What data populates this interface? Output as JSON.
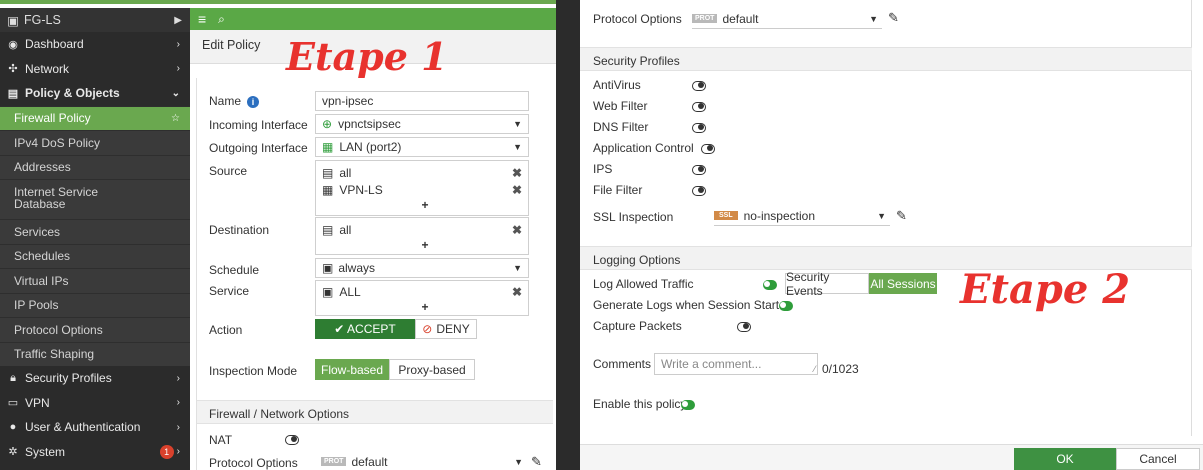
{
  "app": {
    "title": "FG-LS"
  },
  "topbar": {
    "menu_icon": "≡",
    "search_icon": "🔍"
  },
  "sidebar": {
    "items": [
      {
        "label": "Dashboard",
        "icon": "dashboard-icon"
      },
      {
        "label": "Network",
        "icon": "network-icon"
      },
      {
        "label": "Policy & Objects",
        "icon": "policy-icon"
      },
      {
        "label": "Firewall Policy"
      },
      {
        "label": "IPv4 DoS Policy"
      },
      {
        "label": "Addresses"
      },
      {
        "label": "Internet Service Database"
      },
      {
        "label": "Services"
      },
      {
        "label": "Schedules"
      },
      {
        "label": "Virtual IPs"
      },
      {
        "label": "IP Pools"
      },
      {
        "label": "Protocol Options"
      },
      {
        "label": "Traffic Shaping"
      },
      {
        "label": "Security Profiles",
        "icon": "lock-icon"
      },
      {
        "label": "VPN",
        "icon": "monitor-icon"
      },
      {
        "label": "User & Authentication",
        "icon": "user-icon"
      },
      {
        "label": "System",
        "icon": "gear-icon",
        "badge": "1"
      }
    ]
  },
  "edit": {
    "title": "Edit Policy"
  },
  "annotations": {
    "step1": "Etape 1",
    "step2": "Etape 2"
  },
  "form": {
    "name_label": "Name",
    "name_value": "vpn-ipsec",
    "incoming_label": "Incoming Interface",
    "incoming_value": "vpnctsipsec",
    "outgoing_label": "Outgoing Interface",
    "outgoing_value": "LAN (port2)",
    "source_label": "Source",
    "source_values": [
      "all",
      "VPN-LS"
    ],
    "destination_label": "Destination",
    "destination_value": "all",
    "schedule_label": "Schedule",
    "schedule_value": "always",
    "service_label": "Service",
    "service_value": "ALL",
    "action_label": "Action",
    "accept_label": "✔ ACCEPT",
    "deny_label": "⊘ DENY",
    "inspection_label": "Inspection Mode",
    "flow_label": "Flow-based",
    "proxy_label": "Proxy-based",
    "fw_section": "Firewall / Network Options",
    "nat_label": "NAT",
    "proto_label": "Protocol Options",
    "proto_badge": "PROT",
    "proto_value": "default"
  },
  "right": {
    "proto_label": "Protocol Options",
    "proto_badge": "PROT",
    "proto_value": "default",
    "security_section": "Security Profiles",
    "profiles": [
      "AntiVirus",
      "Web Filter",
      "DNS Filter",
      "Application Control",
      "IPS",
      "File Filter"
    ],
    "ssl_label": "SSL Inspection",
    "ssl_badge": "SSL",
    "ssl_value": "no-inspection",
    "logging_section": "Logging Options",
    "log_allowed_label": "Log Allowed Traffic",
    "security_events": "Security Events",
    "all_sessions": "All Sessions",
    "gen_logs_label": "Generate Logs when Session Starts",
    "capture_label": "Capture Packets",
    "comments_label": "Comments",
    "comments_placeholder": "Write a comment...",
    "comments_count": "0/1023",
    "enable_label": "Enable this policy",
    "ok_label": "OK",
    "cancel_label": "Cancel"
  }
}
